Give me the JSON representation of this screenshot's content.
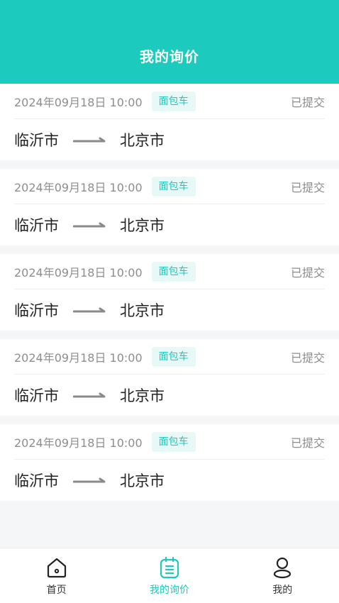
{
  "header": {
    "title": "我的询价"
  },
  "orders": [
    {
      "date": "2024年09月18日 10:00",
      "vehicle": "面包车",
      "status": "已提交",
      "from": "临沂市",
      "to": "北京市"
    },
    {
      "date": "2024年09月18日 10:00",
      "vehicle": "面包车",
      "status": "已提交",
      "from": "临沂市",
      "to": "北京市"
    },
    {
      "date": "2024年09月18日 10:00",
      "vehicle": "面包车",
      "status": "已提交",
      "from": "临沂市",
      "to": "北京市"
    },
    {
      "date": "2024年09月18日 10:00",
      "vehicle": "面包车",
      "status": "已提交",
      "from": "临沂市",
      "to": "北京市"
    },
    {
      "date": "2024年09月18日 10:00",
      "vehicle": "面包车",
      "status": "已提交",
      "from": "临沂市",
      "to": "北京市"
    }
  ],
  "tabbar": {
    "items": [
      {
        "label": "首页",
        "icon": "home-icon",
        "active": false
      },
      {
        "label": "我的询价",
        "icon": "clipboard-icon",
        "active": true
      },
      {
        "label": "我的",
        "icon": "user-icon",
        "active": false
      }
    ]
  },
  "colors": {
    "accent": "#1ccbbd",
    "tag_bg": "#e6f9f7",
    "text_gray": "#8d8d8d",
    "text_dark": "#222222"
  }
}
